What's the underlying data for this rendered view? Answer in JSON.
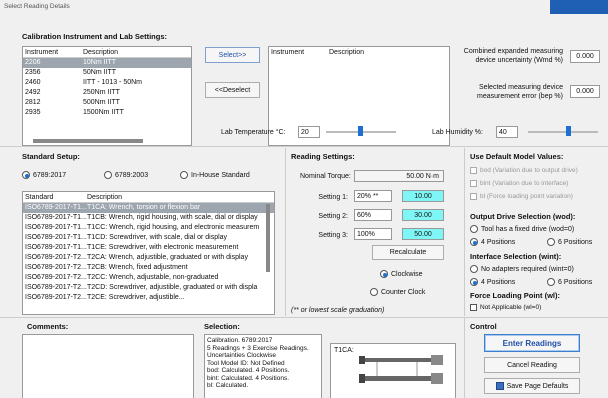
{
  "window_title": "Select Reading Details",
  "calibration": {
    "heading": "Calibration Instrument and Lab Settings:",
    "left_list": {
      "headers": [
        "Instrument",
        "Description"
      ],
      "rows": [
        {
          "instrument": "2206",
          "description": "10Nm IITT"
        },
        {
          "instrument": "2356",
          "description": "50Nm IITT"
        },
        {
          "instrument": "2460",
          "description": "IITT - 1013 - 50Nm"
        },
        {
          "instrument": "2492",
          "description": "250Nm IITT"
        },
        {
          "instrument": "2812",
          "description": "500Nm IITT"
        },
        {
          "instrument": "2935",
          "description": "1500Nm IITT"
        }
      ]
    },
    "select_button": "Select>>",
    "deselect_button": "<<Deselect",
    "right_list": {
      "headers": [
        "Instrument",
        "Description"
      ]
    },
    "combined_label_1": "Combined expanded measuring",
    "combined_label_2": "device uncertainty (Wmd %)",
    "combined_value": "0.000",
    "selected_label_1": "Selected measuring device",
    "selected_label_2": "measurement error (bep %)",
    "selected_value": "0.000",
    "lab_temp_label": "Lab Temperature °C:",
    "lab_temp_value": "20",
    "lab_humidity_label": "Lab Humidity %:",
    "lab_humidity_value": "40"
  },
  "standard": {
    "heading": "Standard Setup:",
    "options": [
      "6789:2017",
      "6789:2003",
      "In-House Standard"
    ],
    "selected": "6789:2017",
    "headers": [
      "Standard",
      "Description"
    ],
    "rows": [
      {
        "standard": "ISO6789-2017-T1...",
        "description": "T1CA: Wrench, torsion or flexion bar"
      },
      {
        "standard": "ISO6789-2017-T1...",
        "description": "T1CB: Wrench, rigid housing, with scale, dial or display"
      },
      {
        "standard": "ISO6789-2017-T1...",
        "description": "T1CC: Wrench, rigid housing, and electronic measurem"
      },
      {
        "standard": "ISO6789-2017-T1...",
        "description": "T1CD: Screwdriver, with scale, dial or display"
      },
      {
        "standard": "ISO6789-2017-T1...",
        "description": "T1CE: Screwdriver, with electronic measurement"
      },
      {
        "standard": "ISO6789-2017-T2...",
        "description": "T2CA: Wrench, adjustible, graduated or with display"
      },
      {
        "standard": "ISO6789-2017-T2...",
        "description": "T2CB: Wrench, fixed adjustment"
      },
      {
        "standard": "ISO6789-2017-T2...",
        "description": "T2CC: Wrench, adjustable, non-graduated"
      },
      {
        "standard": "ISO6789-2017-T2...",
        "description": "T2CD: Screwdriver, adjustible, graduated or with displa"
      },
      {
        "standard": "ISO6789-2017-T2...",
        "description": "T2CE: Screwdriver, adjustible..."
      }
    ]
  },
  "reading": {
    "heading": "Reading Settings:",
    "nominal_label": "Nominal Torque:",
    "nominal_value": "50.00 N·m",
    "settings": [
      {
        "label": "Setting 1:",
        "percent": "20% **",
        "value": "10.00"
      },
      {
        "label": "Setting 2:",
        "percent": "60%",
        "value": "30.00"
      },
      {
        "label": "Setting 3:",
        "percent": "100%",
        "value": "50.00"
      }
    ],
    "recalculate": "Recalculate",
    "clockwise": "Clockwise",
    "counter_clock": "Counter Clock",
    "direction_selected": "Clockwise",
    "footnote": "(** or lowest scale graduation)"
  },
  "model": {
    "heading": "Use Default Model Values:",
    "checks": [
      "bod (Variation due to output drive)",
      "bint (Variation due to interface)",
      "bl (Force loading point variation)"
    ],
    "output_heading": "Output Drive Selection (wod):",
    "output_opt1": "Tool has a fixed drive (wod=0)",
    "output_opt2": "4 Positions",
    "output_opt3": "6 Positions",
    "interface_heading": "Interface Selection (wint):",
    "interface_opt1": "No adapters required (wint=0)",
    "interface_opt2": "4 Positions",
    "interface_opt3": "6 Positions",
    "force_heading": "Force Loading Point (wl):",
    "force_check": "Not Applicable (wl=0)"
  },
  "comments": {
    "heading": "Comments:"
  },
  "selection": {
    "heading": "Selection:",
    "lines": [
      "Calibration. 6789:2017",
      "5 Readings + 3 Exercise Readings.",
      "Uncertainties   Clockwise",
      "Tool Model ID: Not Defined",
      "bod: Calculated. 4 Positions.",
      "bint: Calculated. 4 Positions.",
      "bl: Calculated."
    ],
    "image_label": "T1CA:"
  },
  "control": {
    "heading": "Control",
    "enter": "Enter Readings",
    "cancel": "Cancel Reading",
    "save": "Save Page Defaults"
  }
}
